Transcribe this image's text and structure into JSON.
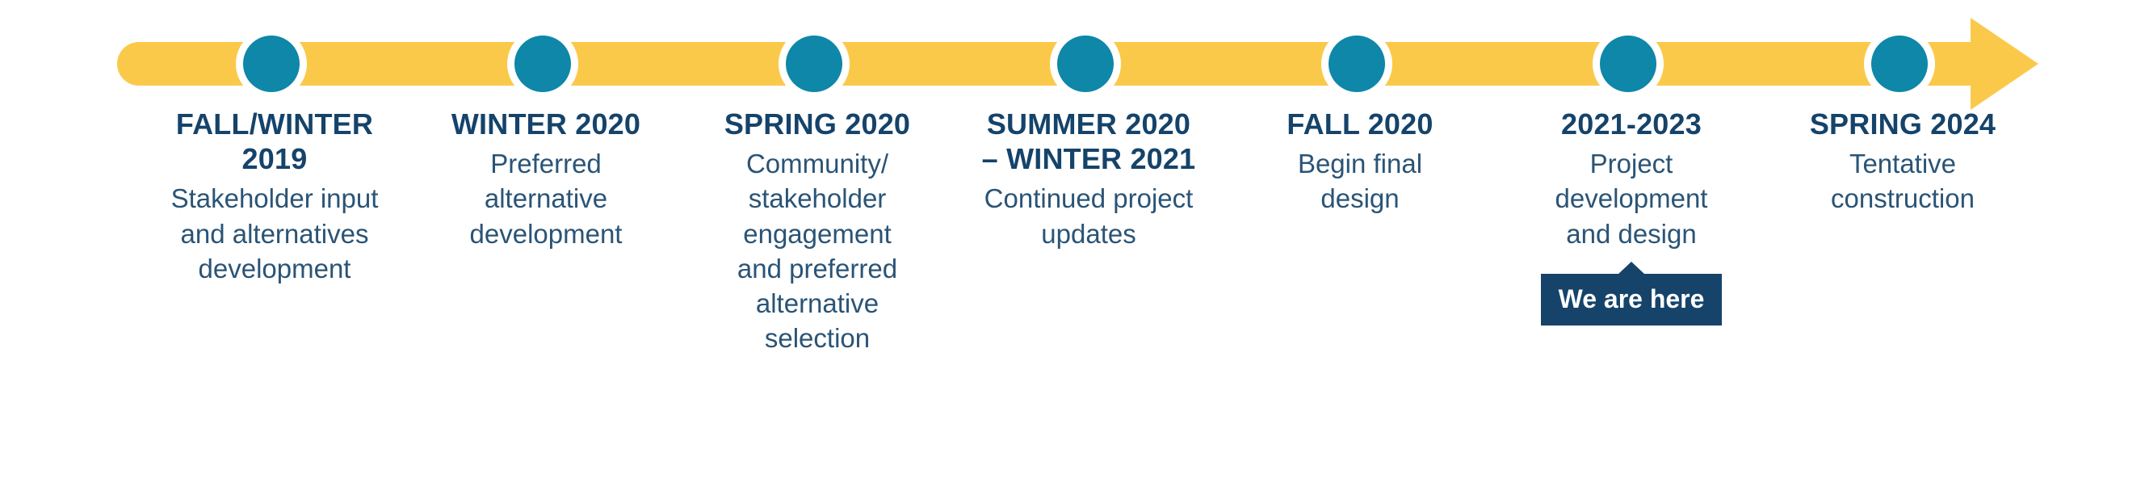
{
  "graphic": {
    "kind": "project-timeline",
    "colors": {
      "track_yellow": "#FBC94A",
      "milestone_teal": "#0E87A8",
      "heading_navy": "#15436A",
      "body_navy": "#2A5476",
      "background": "#FFFFFF",
      "callout_text": "#FFFFFF"
    }
  },
  "milestones": [
    {
      "period": "FALL/WINTER\n2019",
      "description": "Stakeholder input\nand alternatives\ndevelopment"
    },
    {
      "period": "WINTER 2020",
      "description": "Preferred\nalternative\ndevelopment"
    },
    {
      "period": "SPRING 2020",
      "description": "Community/\nstakeholder\nengagement\nand preferred\nalternative\nselection"
    },
    {
      "period": "SUMMER 2020\n– WINTER 2021",
      "description": "Continued project\nupdates"
    },
    {
      "period": "FALL 2020",
      "description": "Begin final\ndesign"
    },
    {
      "period": "2021-2023",
      "description": "Project\ndevelopment\nand design"
    },
    {
      "period": "SPRING 2024",
      "description": "Tentative\nconstruction"
    }
  ],
  "current_marker": {
    "label": "We are here",
    "attached_to_period": "2021-2023"
  }
}
